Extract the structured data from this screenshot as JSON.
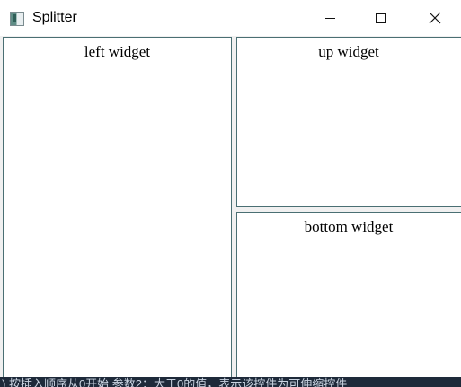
{
  "window": {
    "title": "Splitter",
    "icon": "qt-app-icon",
    "controls": {
      "minimize": "minimize-icon",
      "maximize": "maximize-icon",
      "close": "close-icon"
    }
  },
  "splitter": {
    "left_label": "left widget",
    "up_label": "up widget",
    "bottom_label": "bottom widget"
  },
  "background": {
    "partial_text": ") 按插入顺序从0开始  参数2：大于0的值，表示该控件为可伸缩控件"
  },
  "colors": {
    "pane_border": "#4a6f73",
    "pane_background": "#ffffff",
    "window_background": "#f0f0f0"
  }
}
